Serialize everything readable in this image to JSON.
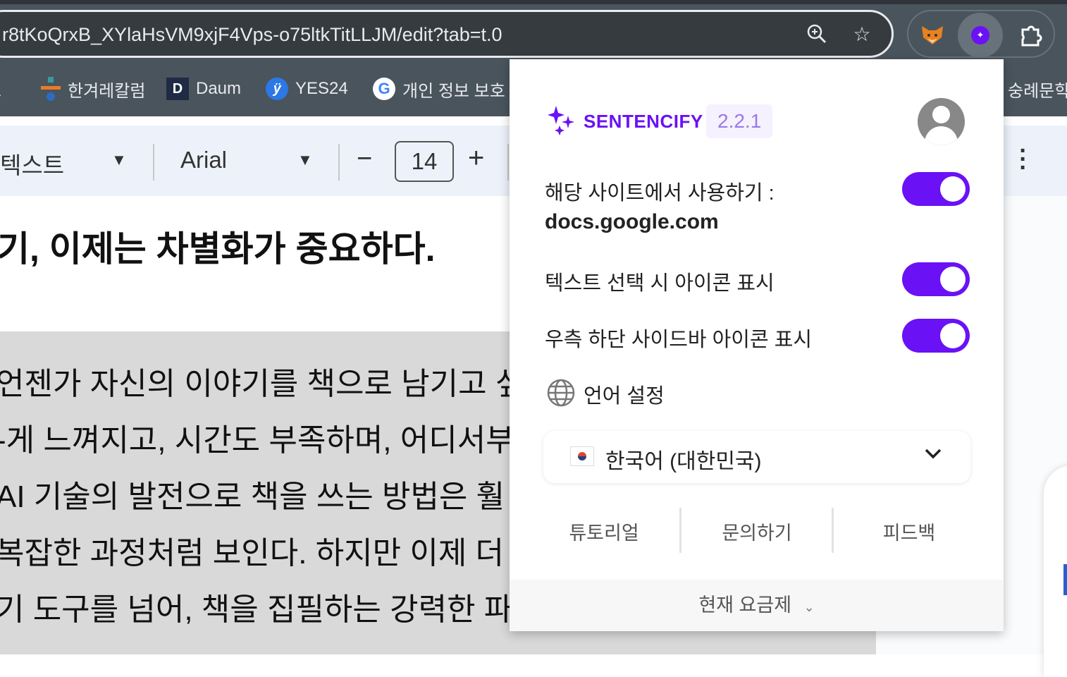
{
  "browser": {
    "url": "r8tKoQrxB_XYlaHsVM9xjF4Vps-o75ltkTitLLJM/edit?tab=t.0",
    "bookmarks": [
      {
        "label": "교"
      },
      {
        "label": "한겨레칼럼"
      },
      {
        "label": "Daum",
        "icon_text": "D"
      },
      {
        "label": "YES24",
        "icon_text": "ÿ"
      },
      {
        "label": "개인 정보 보호 !"
      },
      {
        "label": "숭례문학"
      }
    ]
  },
  "docs_toolbar": {
    "style": "텍스트",
    "font": "Arial",
    "font_size": "14",
    "minus": "−",
    "plus": "+"
  },
  "document": {
    "headline": "기, 이제는 차별화가 중요하다.",
    "lines": [
      "언젠가 자신의 이야기를 책으로 남기고 싶다",
      "-게 느껴지고, 시간도 부족하며, 어디서부",
      "AI 기술의 발전으로 책을 쓰는 방법은 훨",
      "복잡한 과정처럼 보인다. 하지만 이제 더",
      "기 도구를 넘어, 책을 집필하는 강력한 파"
    ]
  },
  "popup": {
    "brand": "SENTENCIFY",
    "version": "2.2.1",
    "brand_color": "#6a11f5",
    "site_label": "해당 사이트에서 사용하기 :",
    "site": "docs.google.com",
    "settings": [
      {
        "label": "해당 사이트에서 사용하기",
        "on": true
      },
      {
        "label": "텍스트 선택 시 아이콘 표시",
        "on": true
      },
      {
        "label": "우측 하단 사이드바 아이콘 표시",
        "on": true
      }
    ],
    "language_heading": "언어 설정",
    "language_value": "한국어 (대한민국)",
    "links": [
      "튜토리얼",
      "문의하기",
      "피드백"
    ],
    "plan_label": "현재 요금제"
  }
}
